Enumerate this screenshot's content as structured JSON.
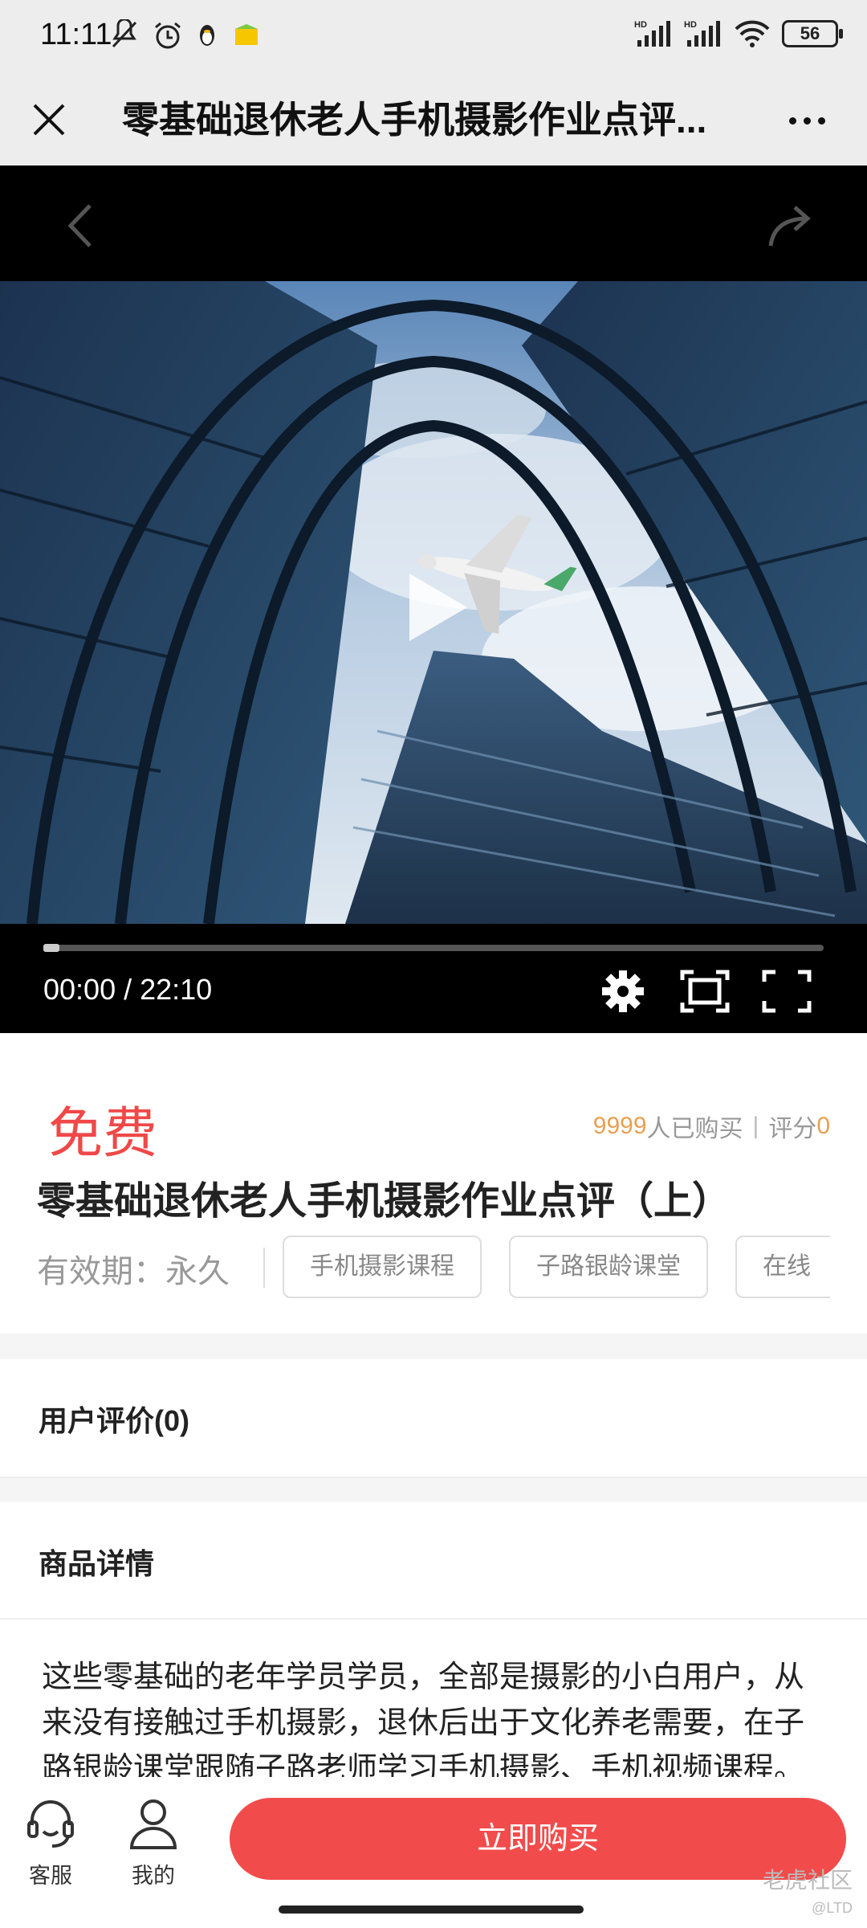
{
  "status_bar": {
    "time": "11:11",
    "battery": "56",
    "network_labels": [
      "HD",
      "HD"
    ]
  },
  "header": {
    "title": "零基础退休老人手机摄影作业点评..."
  },
  "video": {
    "current_time": "00:00",
    "duration": "22:10",
    "time_display": "00:00 / 22:10",
    "progress": 0
  },
  "product": {
    "price": "免费",
    "buyers_count": "9999",
    "buyers_suffix": "人已购买",
    "rating_label": "评分",
    "rating_value": "0",
    "title": "零基础退休老人手机摄影作业点评（上）",
    "validity": "有效期：永久",
    "tags": [
      "手机摄影课程",
      "子路银龄课堂",
      "在线"
    ]
  },
  "sections": {
    "reviews": "用户评价(0)",
    "details": "商品详情"
  },
  "description": "这些零基础的老年学员学员，全部是摄影的小白用户，从来没有接触过手机摄影，退休后出于文化养老需要，在子路银龄课堂跟随子路老师学习手机摄影、手机视频课程。",
  "bottom_bar": {
    "service_label": "客服",
    "mine_label": "我的",
    "buy_label": "立即购买"
  },
  "watermark": {
    "text": "老虎社区",
    "sub": "@LTD"
  },
  "colors": {
    "accent": "#f24b4b",
    "price": "#f04848",
    "count": "#e8a050"
  }
}
